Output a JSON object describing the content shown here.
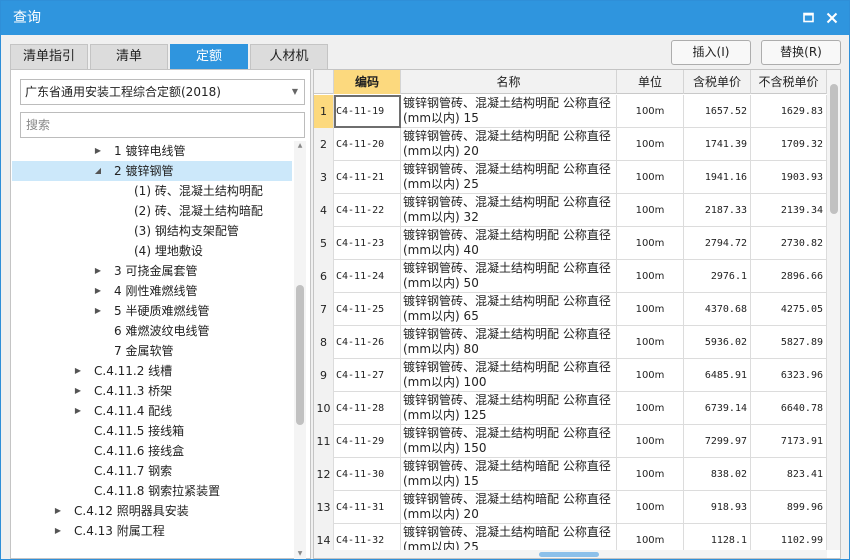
{
  "window": {
    "title": "查询"
  },
  "tabs": [
    {
      "label": "清单指引",
      "active": false
    },
    {
      "label": "清单",
      "active": false
    },
    {
      "label": "定额",
      "active": true
    },
    {
      "label": "人材机",
      "active": false
    }
  ],
  "actions": {
    "insert": "插入(I)",
    "replace": "替换(R)"
  },
  "colors": {
    "accent": "#2f95de",
    "header_highlight": "#fcd97e",
    "selected_tree": "#cce8fa"
  },
  "left_panel": {
    "quota_library": "广东省通用安装工程综合定额(2018)",
    "search_placeholder": "搜索",
    "tree": [
      {
        "label": "1 镀锌电线管",
        "expand": "collapsed",
        "selected": false
      },
      {
        "label": "2 镀锌钢管",
        "expand": "expanded",
        "selected": true
      },
      {
        "label": "(1) 砖、混凝土结构明配",
        "expand": "none",
        "selected": false
      },
      {
        "label": "(2) 砖、混凝土结构暗配",
        "expand": "none",
        "selected": false
      },
      {
        "label": "(3) 钢结构支架配管",
        "expand": "none",
        "selected": false
      },
      {
        "label": "(4) 埋地敷设",
        "expand": "none",
        "selected": false
      },
      {
        "label": "3 可挠金属套管",
        "expand": "collapsed",
        "selected": false
      },
      {
        "label": "4 刚性难燃线管",
        "expand": "collapsed",
        "selected": false
      },
      {
        "label": "5 半硬质难燃线管",
        "expand": "collapsed",
        "selected": false
      },
      {
        "label": "6 难燃波纹电线管",
        "expand": "none",
        "selected": false
      },
      {
        "label": "7 金属软管",
        "expand": "none",
        "selected": false
      },
      {
        "label": "C.4.11.2 线槽",
        "expand": "collapsed",
        "selected": false
      },
      {
        "label": "C.4.11.3 桥架",
        "expand": "collapsed",
        "selected": false
      },
      {
        "label": "C.4.11.4 配线",
        "expand": "collapsed",
        "selected": false
      },
      {
        "label": "C.4.11.5 接线箱",
        "expand": "none",
        "selected": false
      },
      {
        "label": "C.4.11.6 接线盒",
        "expand": "none",
        "selected": false
      },
      {
        "label": "C.4.11.7 钢索",
        "expand": "none",
        "selected": false
      },
      {
        "label": "C.4.11.8 钢索拉紧装置",
        "expand": "none",
        "selected": false
      },
      {
        "label": "C.4.12 照明器具安装",
        "expand": "collapsed",
        "selected": false
      },
      {
        "label": "C.4.13 附属工程",
        "expand": "collapsed",
        "selected": false
      }
    ]
  },
  "grid": {
    "columns": [
      "编码",
      "名称",
      "单位",
      "含税单价",
      "不含税单价"
    ],
    "rows": [
      {
        "index": "1",
        "code": "C4-11-19",
        "name": "镀锌钢管砖、混凝土结构明配 公称直径(mm以内) 15",
        "unit": "100m",
        "price_tax": "1657.52",
        "price_notax": "1629.83"
      },
      {
        "index": "2",
        "code": "C4-11-20",
        "name": "镀锌钢管砖、混凝土结构明配 公称直径(mm以内) 20",
        "unit": "100m",
        "price_tax": "1741.39",
        "price_notax": "1709.32"
      },
      {
        "index": "3",
        "code": "C4-11-21",
        "name": "镀锌钢管砖、混凝土结构明配 公称直径(mm以内) 25",
        "unit": "100m",
        "price_tax": "1941.16",
        "price_notax": "1903.93"
      },
      {
        "index": "4",
        "code": "C4-11-22",
        "name": "镀锌钢管砖、混凝土结构明配 公称直径(mm以内) 32",
        "unit": "100m",
        "price_tax": "2187.33",
        "price_notax": "2139.34"
      },
      {
        "index": "5",
        "code": "C4-11-23",
        "name": "镀锌钢管砖、混凝土结构明配 公称直径(mm以内) 40",
        "unit": "100m",
        "price_tax": "2794.72",
        "price_notax": "2730.82"
      },
      {
        "index": "6",
        "code": "C4-11-24",
        "name": "镀锌钢管砖、混凝土结构明配 公称直径(mm以内) 50",
        "unit": "100m",
        "price_tax": "2976.1",
        "price_notax": "2896.66"
      },
      {
        "index": "7",
        "code": "C4-11-25",
        "name": "镀锌钢管砖、混凝土结构明配 公称直径(mm以内) 65",
        "unit": "100m",
        "price_tax": "4370.68",
        "price_notax": "4275.05"
      },
      {
        "index": "8",
        "code": "C4-11-26",
        "name": "镀锌钢管砖、混凝土结构明配 公称直径(mm以内) 80",
        "unit": "100m",
        "price_tax": "5936.02",
        "price_notax": "5827.89"
      },
      {
        "index": "9",
        "code": "C4-11-27",
        "name": "镀锌钢管砖、混凝土结构明配 公称直径(mm以内) 100",
        "unit": "100m",
        "price_tax": "6485.91",
        "price_notax": "6323.96"
      },
      {
        "index": "10",
        "code": "C4-11-28",
        "name": "镀锌钢管砖、混凝土结构明配 公称直径(mm以内) 125",
        "unit": "100m",
        "price_tax": "6739.14",
        "price_notax": "6640.78"
      },
      {
        "index": "11",
        "code": "C4-11-29",
        "name": "镀锌钢管砖、混凝土结构明配 公称直径(mm以内) 150",
        "unit": "100m",
        "price_tax": "7299.97",
        "price_notax": "7173.91"
      },
      {
        "index": "12",
        "code": "C4-11-30",
        "name": "镀锌钢管砖、混凝土结构暗配 公称直径(mm以内) 15",
        "unit": "100m",
        "price_tax": "838.02",
        "price_notax": "823.41"
      },
      {
        "index": "13",
        "code": "C4-11-31",
        "name": "镀锌钢管砖、混凝土结构暗配 公称直径(mm以内) 20",
        "unit": "100m",
        "price_tax": "918.93",
        "price_notax": "899.96"
      },
      {
        "index": "14",
        "code": "C4-11-32",
        "name": "镀锌钢管砖、混凝土结构暗配 公称直径(mm以内) 25",
        "unit": "100m",
        "price_tax": "1128.1",
        "price_notax": "1102.99"
      }
    ]
  }
}
